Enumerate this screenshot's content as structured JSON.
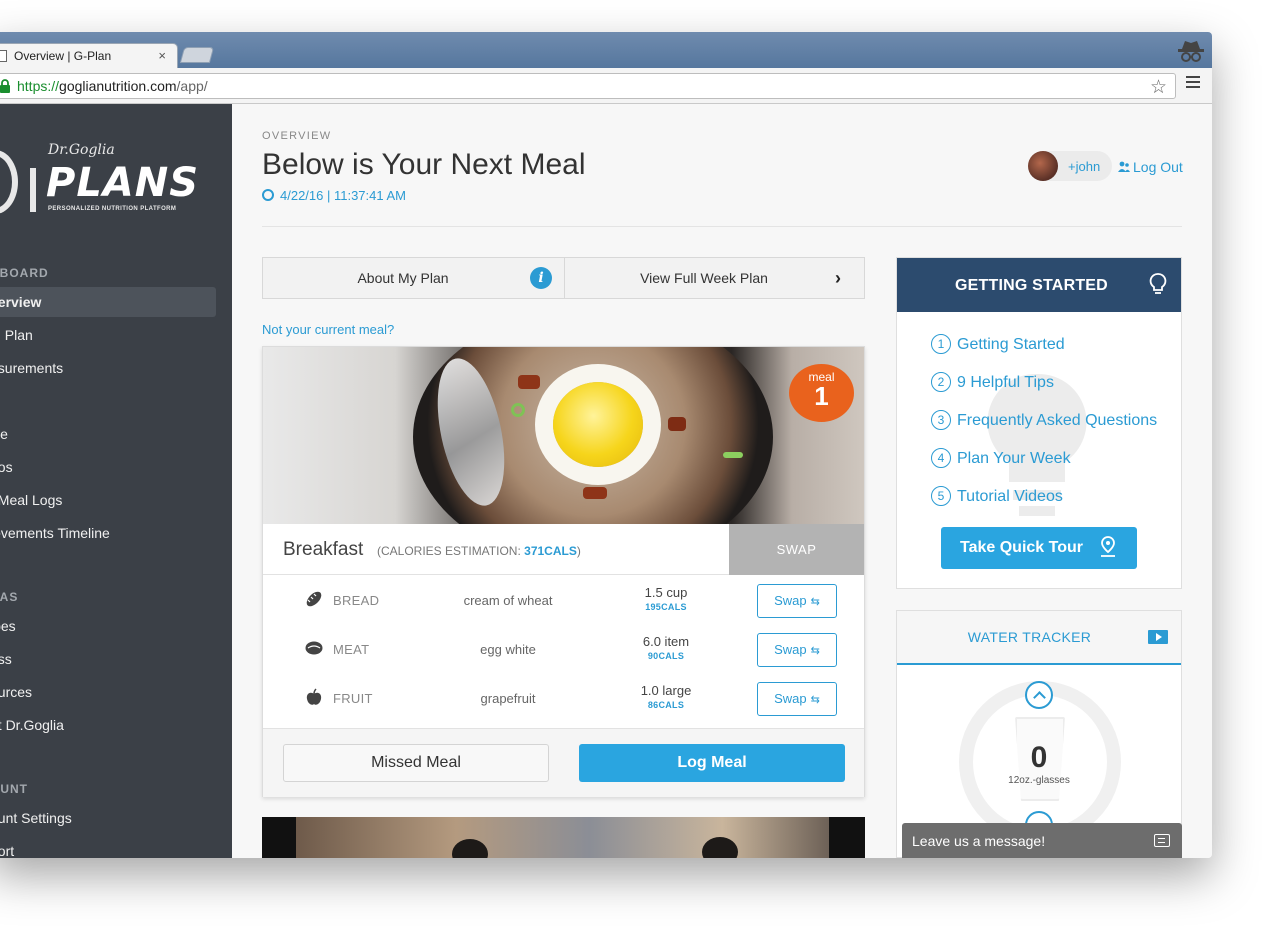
{
  "browser": {
    "tab_title": "Overview | G-Plan",
    "tab_close": "×",
    "url_https": "https://",
    "url_domain": "goglianutrition.com",
    "url_path": "/app/",
    "star": "☆"
  },
  "sidebar": {
    "logo_script": "Dr.Goglia",
    "logo_word": "PLANS",
    "logo_sub": "PERSONALIZED NUTRITION PLATFORM",
    "sections": [
      {
        "title": "HBOARD",
        "items": [
          "verview",
          "al Plan",
          "asurements",
          "p",
          "file",
          "eos",
          "t Meal Logs",
          "ievements Timeline"
        ]
      },
      {
        "title": "RAS",
        "items": [
          "ipes",
          "ess",
          "ources",
          "ut Dr.Goglia"
        ]
      },
      {
        "title": "OUNT",
        "items": [
          "ount Settings",
          "port"
        ]
      }
    ]
  },
  "header": {
    "overview_label": "OVERVIEW",
    "title": "Below is Your Next Meal",
    "timestamp": "4/22/16 | 11:37:41 AM",
    "username": "+john",
    "logout": "Log Out"
  },
  "plan_bar": {
    "about": "About My Plan",
    "info_glyph": "i",
    "full_week": "View Full Week Plan",
    "chevron": "›"
  },
  "not_current": "Not your current meal?",
  "meal": {
    "badge_word": "meal",
    "badge_num": "1",
    "name": "Breakfast",
    "cal_prefix": "(CALORIES ESTIMATION: ",
    "cal_value": "371CALS",
    "cal_suffix": ")",
    "swap_all": "SWAP",
    "foods": [
      {
        "category": "BREAD",
        "name": "cream of wheat",
        "qty": "1.5 cup",
        "cals": "195CALS",
        "icon": "bread-icon"
      },
      {
        "category": "MEAT",
        "name": "egg white",
        "qty": "6.0 item",
        "cals": "90CALS",
        "icon": "meat-icon"
      },
      {
        "category": "FRUIT",
        "name": "grapefruit",
        "qty": "1.0 large",
        "cals": "86CALS",
        "icon": "apple-icon"
      }
    ],
    "swap_label": "Swap",
    "swap_glyph": "⇆",
    "missed": "Missed Meal",
    "log": "Log Meal"
  },
  "getting_started": {
    "title": "GETTING STARTED",
    "items": [
      {
        "num": "1",
        "label": "Getting Started"
      },
      {
        "num": "2",
        "label": "9 Helpful Tips"
      },
      {
        "num": "3",
        "label": "Frequently Asked Questions"
      },
      {
        "num": "4",
        "label": "Plan Your Week"
      },
      {
        "num": "5",
        "label": "Tutorial Videos"
      }
    ],
    "tour_button": "Take Quick Tour"
  },
  "water": {
    "title": "WATER TRACKER",
    "count": "0",
    "unit": "12oz.-glasses"
  },
  "chat": {
    "label": "Leave us a message!"
  },
  "colors": {
    "accent": "#2b9bd3",
    "sidebar": "#3b4047",
    "panel_header": "#2c4b6e",
    "badge": "#e9621d"
  }
}
